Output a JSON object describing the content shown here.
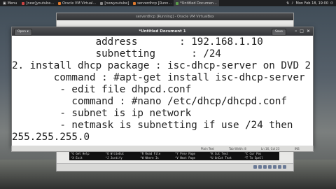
{
  "panel": {
    "menu_label": "Menu",
    "tasks": [
      {
        "label": "[new]youtube...",
        "active": false
      },
      {
        "label": "Oracle VM Virtual...",
        "active": false
      },
      {
        "label": "[newyoutube]",
        "active": false
      },
      {
        "label": "serverdhcp [Runn...",
        "active": false
      },
      {
        "label": "*Untitled Documen...",
        "active": true
      }
    ],
    "clock": "Mon Feb 18, 19:00"
  },
  "background_window": {
    "title": "serverdhcp [Running] - Oracle VM VirtualBox",
    "nano_shortcuts": [
      "^G Get Help",
      "^O WriteOut",
      "^R Read File",
      "^Y Prev Page",
      "^K Cut Text",
      "^C Cur Pos",
      "^X Exit",
      "^J Justify",
      "^W Where Is",
      "^V Next Page",
      "^U UnCut Text",
      "^T To Spell"
    ]
  },
  "editor_window": {
    "title": "*Untitled Document 1",
    "open_label": "Open",
    "save_label": "Save",
    "lines": [
      "              address       : 192.168.1.10",
      "              subnetting      : /24",
      "2. install dhcp package : isc-dhcp-server on DVD 2",
      "       command : #apt-get install isc-dhcp-server",
      "        - edit file dhpcd.conf",
      "          command : #nano /etc/dhcp/dhcpd.conf",
      "        - subnet is ip network",
      "        - netmask is subnetting if use /24 then",
      "255.255.255.0"
    ],
    "status": {
      "mode": "Plain Text",
      "tab_width": "Tab Width: 8",
      "position": "Ln 16, Col 23",
      "insert": "INS"
    }
  }
}
